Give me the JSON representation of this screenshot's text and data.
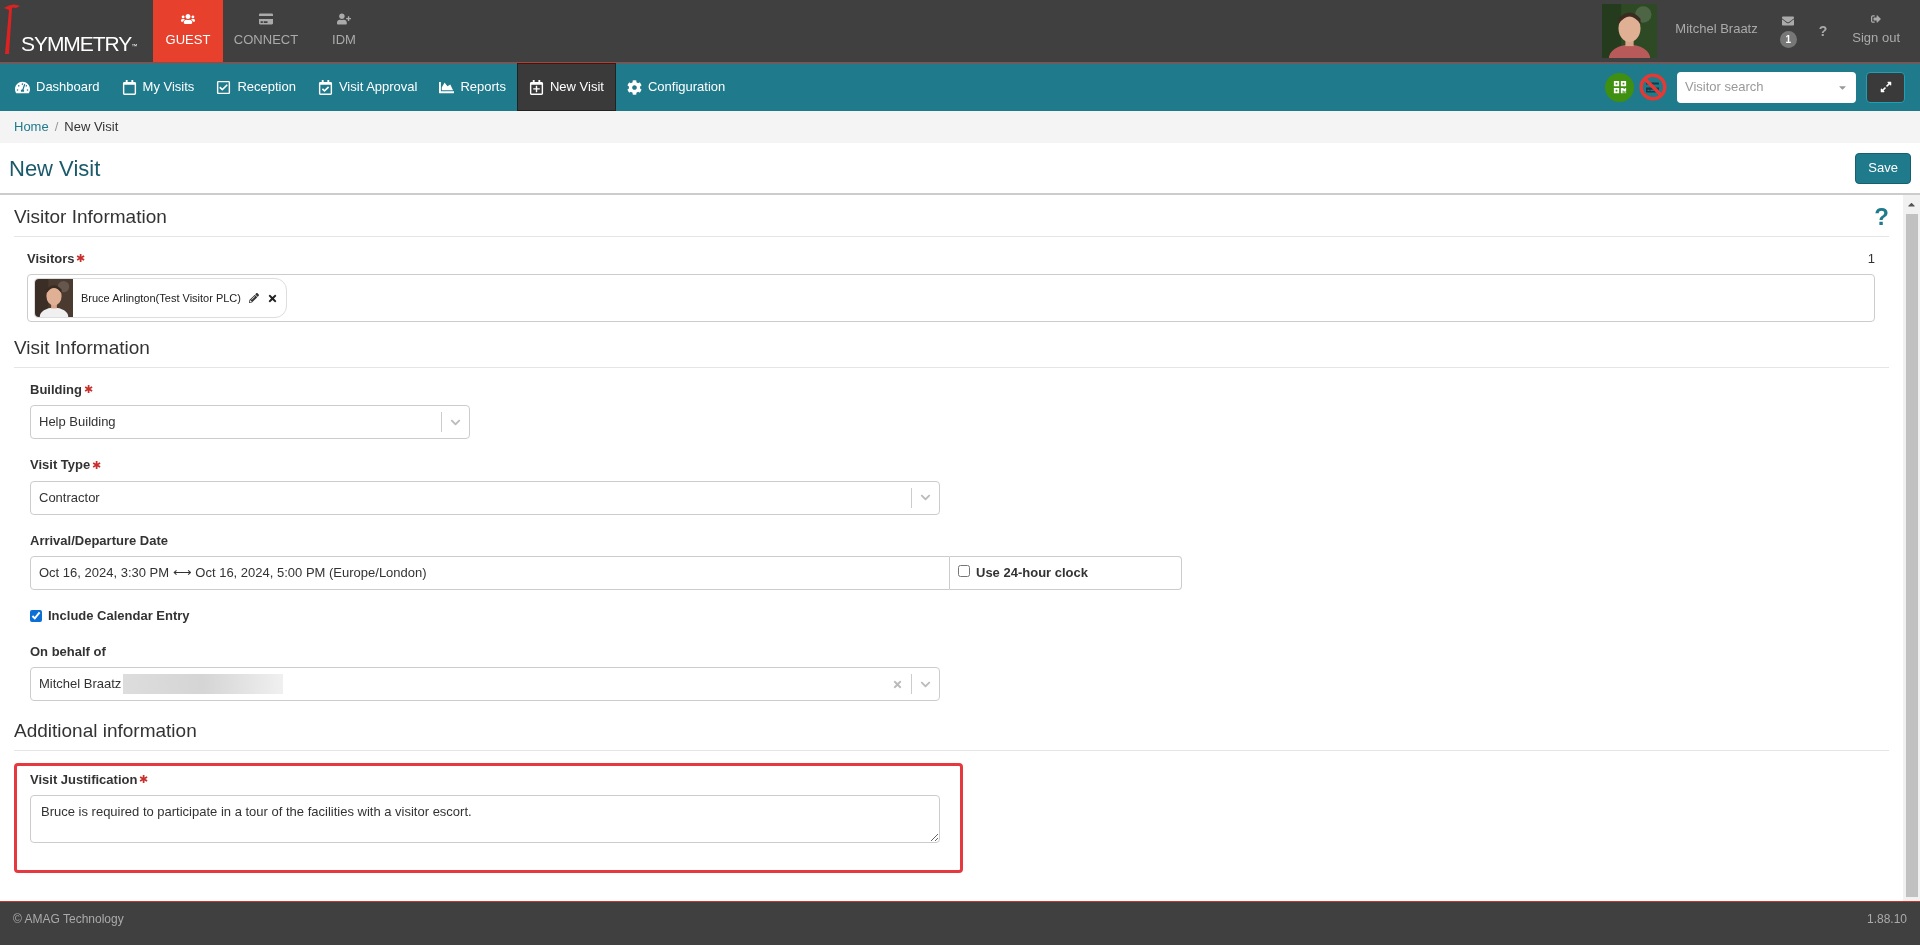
{
  "header": {
    "logo": "SYMMETRY",
    "logo_mark": "™",
    "modules": [
      {
        "label": "GUEST",
        "selected": true
      },
      {
        "label": "CONNECT",
        "selected": false
      },
      {
        "label": "IDM",
        "selected": false
      }
    ],
    "user": {
      "name": "Mitchel Braatz"
    },
    "messages": {
      "count": "1"
    },
    "help": "?",
    "sign_out": "Sign out"
  },
  "nav": {
    "items": [
      {
        "label": "Dashboard",
        "selected": false
      },
      {
        "label": "My Visits",
        "selected": false
      },
      {
        "label": "Reception",
        "selected": false
      },
      {
        "label": "Visit Approval",
        "selected": false
      },
      {
        "label": "Reports",
        "selected": false
      },
      {
        "label": "New Visit",
        "selected": true
      },
      {
        "label": "Configuration",
        "selected": false
      }
    ],
    "search": {
      "placeholder": "Visitor search"
    }
  },
  "breadcrumb": {
    "separator": "/",
    "items": [
      "Home",
      "New Visit"
    ]
  },
  "page": {
    "title": "New Visit",
    "save": "Save"
  },
  "sections": [
    {
      "title": "Visitor Information",
      "help": "?",
      "fields": [
        {
          "kind": "visitors",
          "label": "Visitors",
          "required_mark": "✱",
          "count": "1",
          "visitors": [
            {
              "name": "Bruce Arlington(Test Visitor PLC)"
            }
          ]
        }
      ]
    },
    {
      "title": "Visit Information",
      "fields": [
        {
          "kind": "select",
          "label": "Building",
          "required_mark": "✱",
          "value": "Help Building",
          "clearable": false
        },
        {
          "kind": "select",
          "label": "Visit Type",
          "required_mark": "✱",
          "value": "Contractor",
          "clearable": false
        },
        {
          "kind": "daterange",
          "label": "Arrival/Departure Date",
          "start": "Oct 16, 2024, 3:30 PM",
          "arrow": "⟷",
          "end": "Oct 16, 2024, 5:00 PM (Europe/London)",
          "clock_label": "Use 24-hour clock",
          "clock_checked": false
        },
        {
          "kind": "checkbox",
          "label": "Include Calendar Entry",
          "checked": true
        },
        {
          "kind": "select",
          "label": "On behalf of",
          "value": "Mitchel Braatz",
          "clearable": true,
          "redacted": true
        }
      ]
    },
    {
      "title": "Additional information",
      "fields": [
        {
          "kind": "textarea",
          "label": "Visit Justification",
          "required_mark": "✱",
          "value": "Bruce is required to participate in a tour of the facilities with a visitor escort.",
          "highlighted": true
        }
      ]
    }
  ],
  "footer": {
    "copyright": "© AMAG Technology",
    "version": "1.88.10"
  }
}
